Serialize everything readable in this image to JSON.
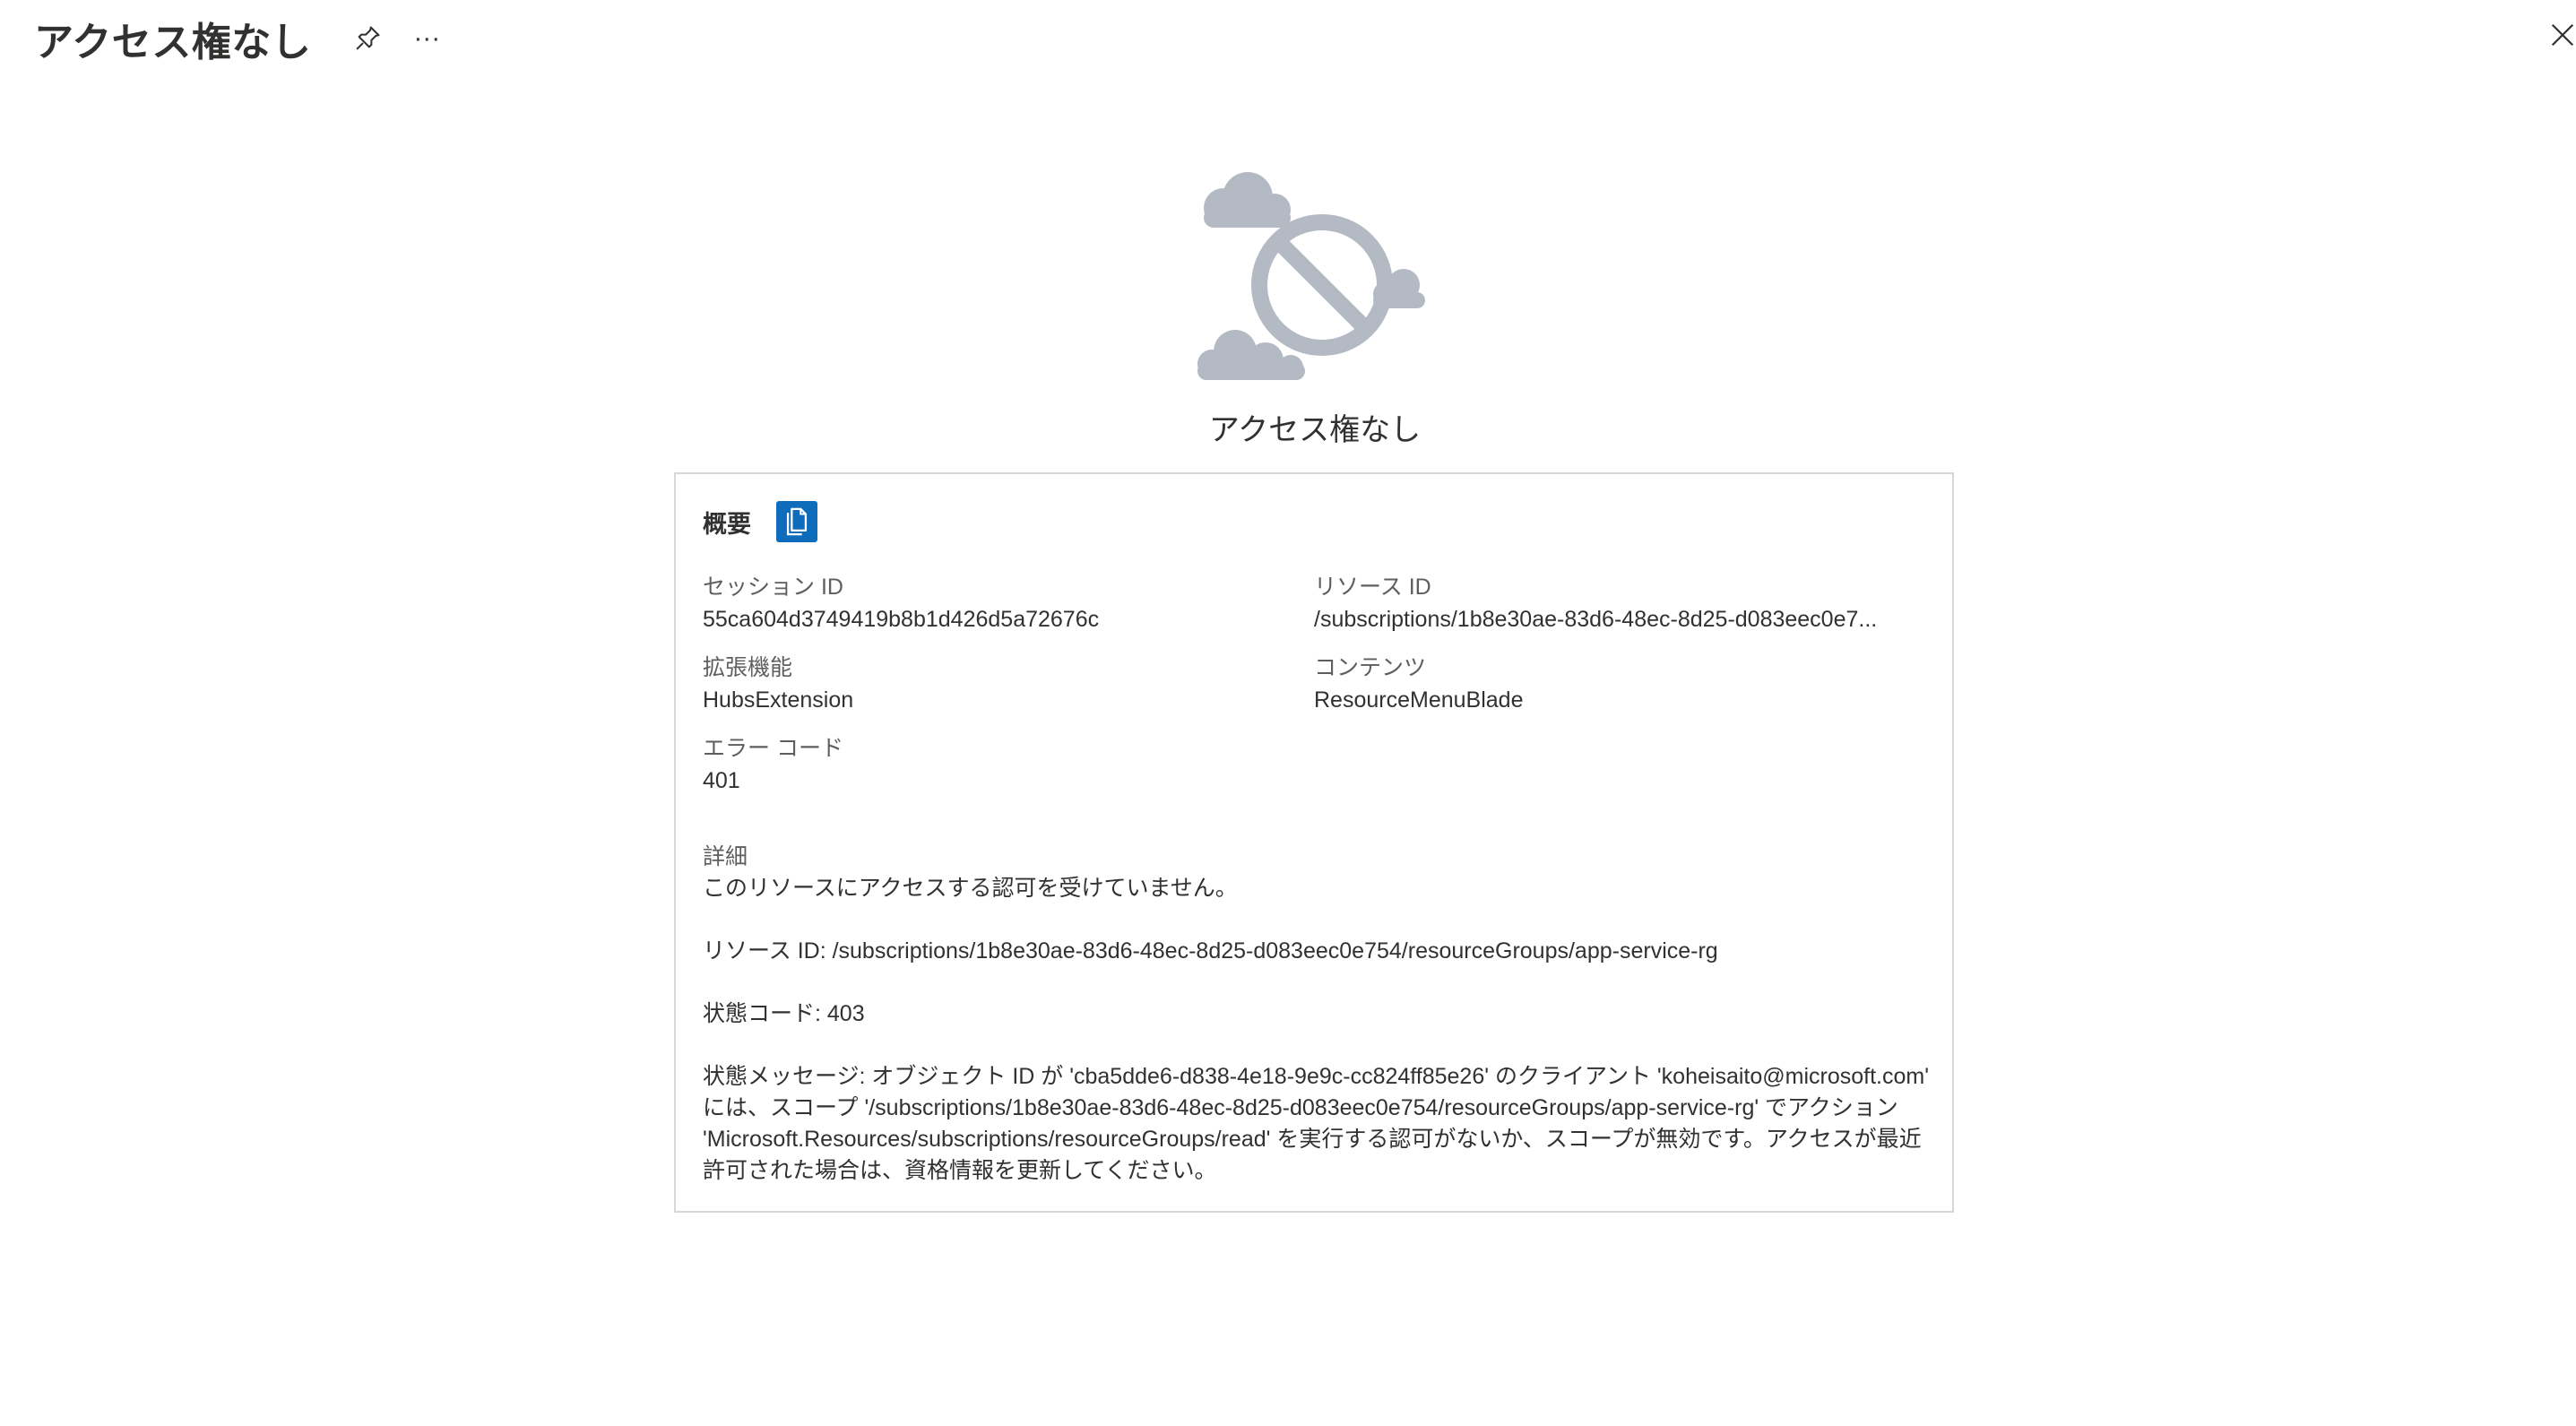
{
  "header": {
    "title": "アクセス権なし",
    "more_label": "···"
  },
  "icons": {
    "pin": "pin-icon",
    "more": "more-options-icon",
    "close": "close-icon",
    "hero": "no-access-cloud-icon",
    "copy": "copy-icon"
  },
  "hero": {
    "title": "アクセス権なし"
  },
  "summary": {
    "heading": "概要",
    "session_id_label": "セッション ID",
    "session_id_value": "55ca604d3749419b8b1d426d5a72676c",
    "resource_id_label": "リソース ID",
    "resource_id_value": "/subscriptions/1b8e30ae-83d6-48ec-8d25-d083eec0e7...",
    "extension_label": "拡張機能",
    "extension_value": "HubsExtension",
    "content_label": "コンテンツ",
    "content_value": "ResourceMenuBlade",
    "error_code_label": "エラー コード",
    "error_code_value": "401"
  },
  "details": {
    "label": "詳細",
    "line1": "このリソースにアクセスする認可を受けていません。",
    "line2": "リソース ID: /subscriptions/1b8e30ae-83d6-48ec-8d25-d083eec0e754/resourceGroups/app-service-rg",
    "line3": "状態コード: 403",
    "line4": "状態メッセージ: オブジェクト ID が 'cba5dde6-d838-4e18-9e9c-cc824ff85e26' のクライアント 'koheisaito@microsoft.com' には、スコープ '/subscriptions/1b8e30ae-83d6-48ec-8d25-d083eec0e754/resourceGroups/app-service-rg' でアクション 'Microsoft.Resources/subscriptions/resourceGroups/read' を実行する認可がないか、スコープが無効です。アクセスが最近許可された場合は、資格情報を更新してください。"
  },
  "colors": {
    "accent": "#0f6cbd",
    "icon_gray": "#b4bac3",
    "border": "#d8d8d8"
  }
}
